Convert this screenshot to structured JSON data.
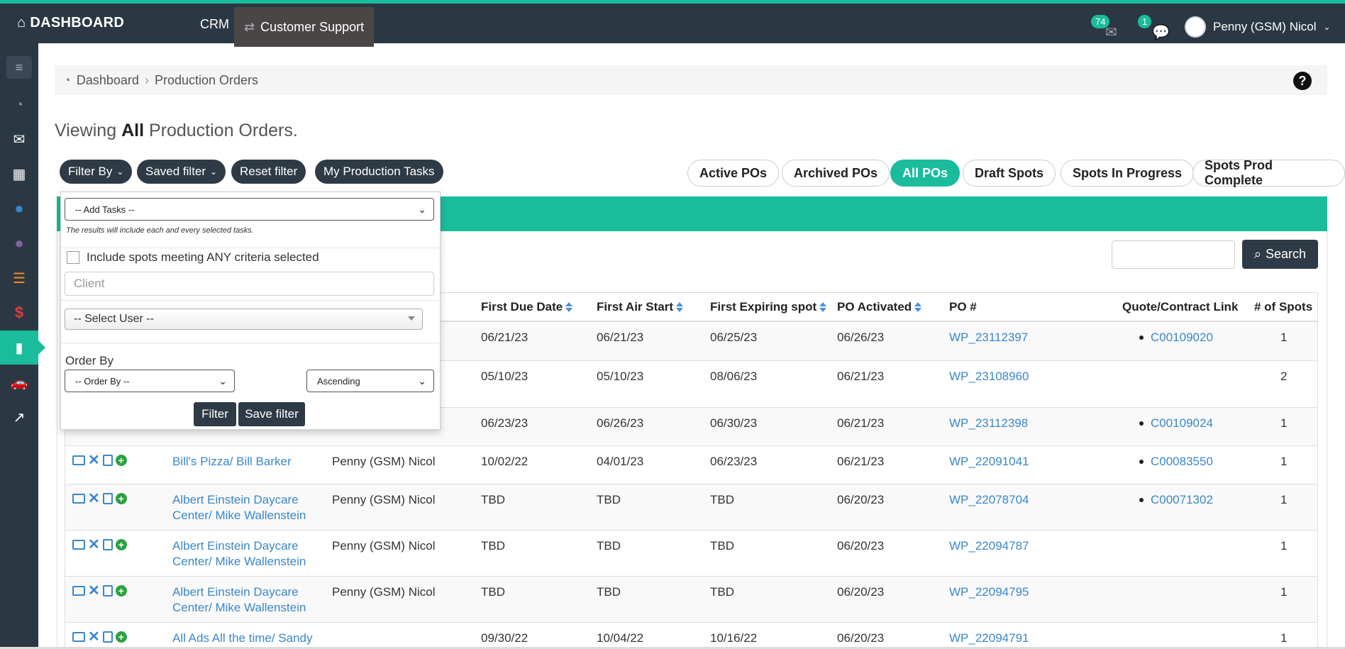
{
  "topbar": {
    "brand": "DASHBOARD",
    "nav_crm": "CRM",
    "nav_support": "Customer Support",
    "mail_count": "74",
    "chat_count": "1",
    "user_name": "Penny (GSM) Nicol"
  },
  "breadcrumb": {
    "home": "Dashboard",
    "current": "Production Orders"
  },
  "page_title": {
    "prefix": "Viewing",
    "bold": "All",
    "suffix": "Production Orders."
  },
  "filters": {
    "filter_by": "Filter By",
    "saved_filter": "Saved filter",
    "reset_filter": "Reset filter",
    "my_tasks": "My Production Tasks"
  },
  "tabs": [
    "Active POs",
    "Archived POs",
    "All POs",
    "Draft Spots",
    "Spots In Progress",
    "Spots Prod Complete"
  ],
  "active_tab": "All POs",
  "search": {
    "button": "Search",
    "value": ""
  },
  "dropdown": {
    "add_tasks": "-- Add Tasks --",
    "note": "The results will include each and every selected tasks.",
    "include_any": "Include spots meeting ANY criteria selected",
    "client_placeholder": "Client",
    "select_user": "-- Select User --",
    "order_by_label": "Order By",
    "order_by": "-- Order By --",
    "direction": "Ascending",
    "filter_btn": "Filter",
    "save_btn": "Save filter"
  },
  "table": {
    "headers": [
      "First Due Date",
      "First Air Start",
      "First Expiring spot",
      "PO Activated",
      "PO #",
      "Quote/Contract Link",
      "# of Spots"
    ],
    "rows": [
      {
        "client": "",
        "user": "",
        "due": "06/21/23",
        "air": "06/21/23",
        "exp": "06/25/23",
        "act": "06/26/23",
        "po": "WP_23112397",
        "quote": "C00109020",
        "spots": "1"
      },
      {
        "client": "",
        "user": "",
        "due": "05/10/23",
        "air": "05/10/23",
        "exp": "08/06/23",
        "act": "06/21/23",
        "po": "WP_23108960",
        "quote": "",
        "spots": "2"
      },
      {
        "client": "",
        "user": "",
        "due": "06/23/23",
        "air": "06/26/23",
        "exp": "06/30/23",
        "act": "06/21/23",
        "po": "WP_23112398",
        "quote": "C00109024",
        "spots": "1"
      },
      {
        "client": "Bill's Pizza/ Bill Barker",
        "user": "Penny (GSM) Nicol",
        "due": "10/02/22",
        "air": "04/01/23",
        "exp": "06/23/23",
        "act": "06/21/23",
        "po": "WP_22091041",
        "quote": "C00083550",
        "spots": "1"
      },
      {
        "client": "Albert Einstein Daycare Center/ Mike Wallenstein",
        "user": "Penny (GSM) Nicol",
        "due": "TBD",
        "air": "TBD",
        "exp": "TBD",
        "act": "06/20/23",
        "po": "WP_22078704",
        "quote": "C00071302",
        "spots": "1"
      },
      {
        "client": "Albert Einstein Daycare Center/ Mike Wallenstein",
        "user": "Penny (GSM) Nicol",
        "due": "TBD",
        "air": "TBD",
        "exp": "TBD",
        "act": "06/20/23",
        "po": "WP_22094787",
        "quote": "",
        "spots": "1"
      },
      {
        "client": "Albert Einstein Daycare Center/ Mike Wallenstein",
        "user": "Penny (GSM) Nicol",
        "due": "TBD",
        "air": "TBD",
        "exp": "TBD",
        "act": "06/20/23",
        "po": "WP_22094795",
        "quote": "",
        "spots": "1"
      },
      {
        "client": "All Ads All the time/ Sandy",
        "user": "",
        "due": "09/30/22",
        "air": "10/04/22",
        "exp": "10/16/22",
        "act": "06/20/23",
        "po": "WP_22094791",
        "quote": "",
        "spots": "1"
      }
    ]
  },
  "colors": {
    "accent": "#1abc9c",
    "dark": "#2b3844",
    "link": "#3a87c9"
  },
  "sidebar_icons": [
    "menu-icon",
    "dashboard-icon",
    "mail-icon",
    "building-icon",
    "user-circle-icon",
    "user-circle-purple-icon",
    "layers-icon",
    "dollar-icon",
    "production-icon",
    "car-icon",
    "chart-icon"
  ]
}
